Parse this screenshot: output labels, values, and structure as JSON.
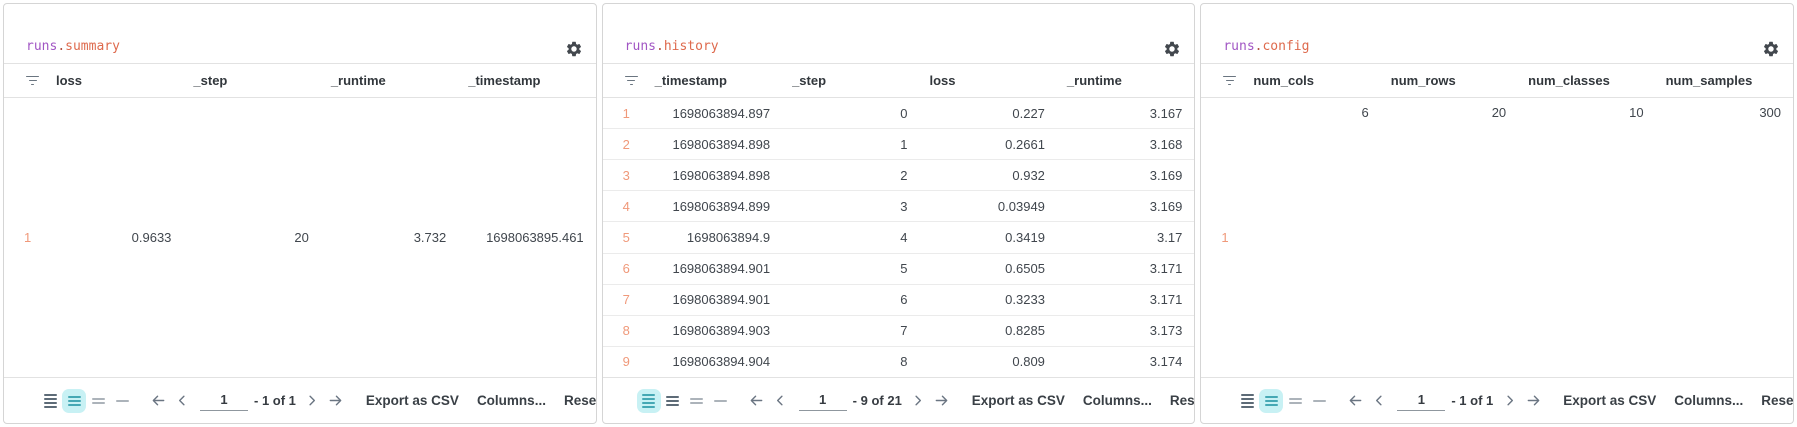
{
  "colors": {
    "title_prefix": "#a156c4",
    "title_suffix": "#de6a4d",
    "row_index": "#f0997a",
    "selected_row_height_bg": "#c8f1f4",
    "selected_row_height_icon": "#45a8b4",
    "header_text": "#32373c",
    "cell_text": "#40464d"
  },
  "panels": [
    {
      "title": {
        "prefix": "runs",
        "separator": ".",
        "suffix": "summary"
      },
      "columns": [
        "loss",
        "_step",
        "_runtime",
        "_timestamp"
      ],
      "body_layout": "layout-center",
      "rows": [
        {
          "index": "1",
          "values": [
            "0.9633",
            "20",
            "3.732",
            "1698063895.461"
          ]
        }
      ],
      "footer": {
        "row_height_options": [
          {
            "name": "compact",
            "bars": 4,
            "selected": false
          },
          {
            "name": "medium",
            "bars": 3,
            "selected": true
          },
          {
            "name": "tall",
            "bars": 2,
            "selected": false
          },
          {
            "name": "extra-tall",
            "bars": 1,
            "selected": false
          }
        ],
        "page": "1",
        "range": "- 1 of 1",
        "export_label": "Export as CSV",
        "columns_label": "Columns...",
        "reset_label": "Reset table"
      }
    },
    {
      "title": {
        "prefix": "runs",
        "separator": ".",
        "suffix": "history"
      },
      "columns": [
        "_timestamp",
        "_step",
        "loss",
        "_runtime"
      ],
      "body_layout": "layout-rows",
      "rows": [
        {
          "index": "1",
          "values": [
            "1698063894.897",
            "0",
            "0.227",
            "3.167"
          ]
        },
        {
          "index": "2",
          "values": [
            "1698063894.898",
            "1",
            "0.2661",
            "3.168"
          ]
        },
        {
          "index": "3",
          "values": [
            "1698063894.898",
            "2",
            "0.932",
            "3.169"
          ]
        },
        {
          "index": "4",
          "values": [
            "1698063894.899",
            "3",
            "0.03949",
            "3.169"
          ]
        },
        {
          "index": "5",
          "values": [
            "1698063894.9",
            "4",
            "0.3419",
            "3.17"
          ]
        },
        {
          "index": "6",
          "values": [
            "1698063894.901",
            "5",
            "0.6505",
            "3.171"
          ]
        },
        {
          "index": "7",
          "values": [
            "1698063894.901",
            "6",
            "0.3233",
            "3.171"
          ]
        },
        {
          "index": "8",
          "values": [
            "1698063894.903",
            "7",
            "0.8285",
            "3.173"
          ]
        },
        {
          "index": "9",
          "values": [
            "1698063894.904",
            "8",
            "0.809",
            "3.174"
          ]
        }
      ],
      "footer": {
        "row_height_options": [
          {
            "name": "compact",
            "bars": 4,
            "selected": true
          },
          {
            "name": "medium",
            "bars": 3,
            "selected": false
          },
          {
            "name": "tall",
            "bars": 2,
            "selected": false
          },
          {
            "name": "extra-tall",
            "bars": 1,
            "selected": false
          }
        ],
        "page": "1",
        "range": "- 9 of 21",
        "export_label": "Export as CSV",
        "columns_label": "Columns...",
        "reset_label": "Reset table"
      }
    },
    {
      "title": {
        "prefix": "runs",
        "separator": ".",
        "suffix": "config"
      },
      "columns": [
        "num_cols",
        "num_rows",
        "num_classes",
        "num_samples"
      ],
      "body_layout": "layout-top",
      "rows": [
        {
          "index": "1",
          "values": [
            "6",
            "20",
            "10",
            "300"
          ]
        }
      ],
      "footer": {
        "row_height_options": [
          {
            "name": "compact",
            "bars": 4,
            "selected": false
          },
          {
            "name": "medium",
            "bars": 3,
            "selected": true
          },
          {
            "name": "tall",
            "bars": 2,
            "selected": false
          },
          {
            "name": "extra-tall",
            "bars": 1,
            "selected": false
          }
        ],
        "page": "1",
        "range": "- 1 of 1",
        "export_label": "Export as CSV",
        "columns_label": "Columns...",
        "reset_label": "Reset table"
      }
    }
  ]
}
